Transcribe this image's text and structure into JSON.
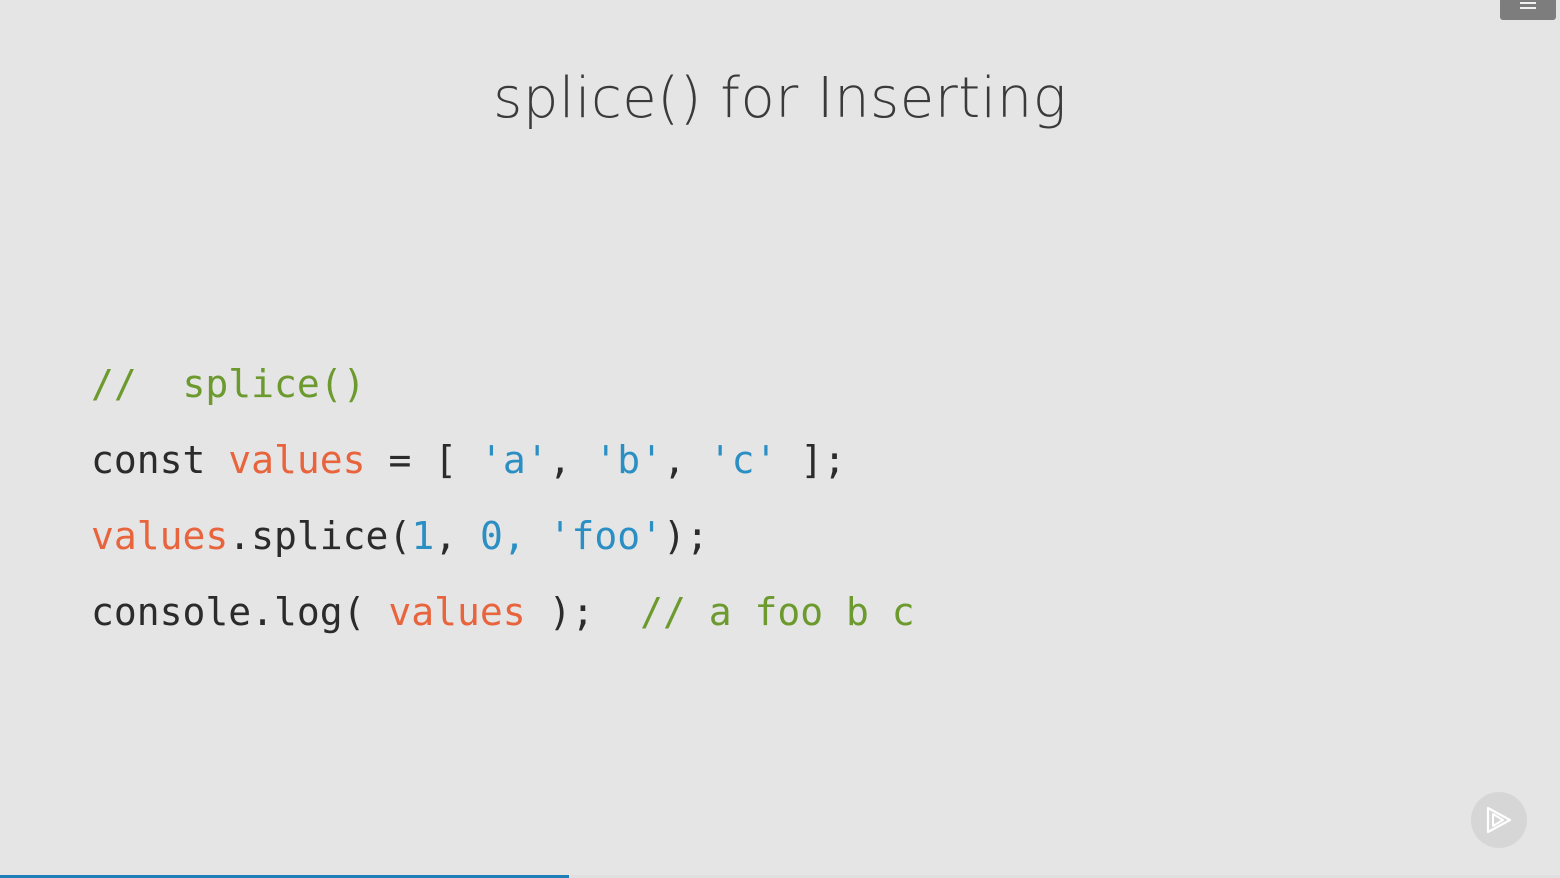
{
  "slide": {
    "title": "splice() for Inserting"
  },
  "code": {
    "line1": {
      "comment": "//  splice()"
    },
    "line2": {
      "kw": "const ",
      "var": "values",
      "op": " = [ ",
      "s1": "'a'",
      "sep1": ", ",
      "s2": "'b'",
      "sep2": ", ",
      "s3": "'c'",
      "end": " ];"
    },
    "line3": {
      "var": "values",
      "call": ".splice(",
      "n1": "1",
      "sep1": ", ",
      "n2": "0, ",
      "s1": "'foo'",
      "end": ");"
    },
    "line4": {
      "call": "console.log( ",
      "var": "values",
      "end": " );  ",
      "comment": "// a foo b c"
    }
  },
  "controls": {
    "menu_icon": "menu-icon",
    "play_icon": "play-icon"
  },
  "progress": {
    "fraction": 0.365,
    "color": "#1f7fb8"
  },
  "colors": {
    "comment": "#6c9a2e",
    "variable": "#e8643c",
    "string": "#2b8fc4",
    "plain": "#2b2b2b",
    "background": "#e5e5e5"
  }
}
